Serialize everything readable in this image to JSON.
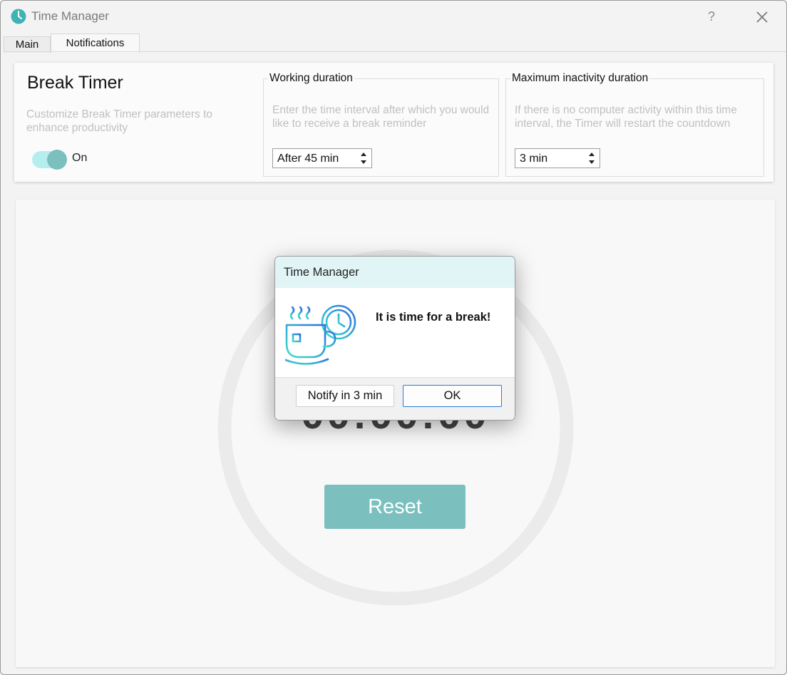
{
  "window": {
    "title": "Time Manager",
    "help_label": "?",
    "app_icon": "clock-icon",
    "close_icon": "close-icon"
  },
  "tabs": [
    {
      "label": "Main",
      "selected": false
    },
    {
      "label": "Notifications",
      "selected": true
    }
  ],
  "break_timer": {
    "title": "Break Timer",
    "description": "Customize Break Timer parameters to enhance productivity",
    "toggle_state": "On",
    "toggle_on": true
  },
  "working_duration": {
    "label": "Working duration",
    "description": "Enter the time interval after which you would like to receive a break reminder",
    "value": "After 45 min"
  },
  "inactivity_duration": {
    "label": "Maximum inactivity duration",
    "description": "If there is no computer activity within this time interval, the Timer will restart the countdown",
    "value": "3 min"
  },
  "timer": {
    "display": "00:00:00",
    "reset_label": "Reset"
  },
  "dialog": {
    "title": "Time Manager",
    "message": "It is time for a break!",
    "icon": "coffee-cup-clock-icon",
    "notify_label": "Notify in 3 min",
    "ok_label": "OK"
  },
  "colors": {
    "accent": "#7bbfbf",
    "toggle_track": "#b6eef0",
    "dialog_header": "#e2f5f6",
    "ok_border": "#2a7bd4",
    "icon_gradient_start": "#3fd6c8",
    "icon_gradient_end": "#2f6fe0"
  }
}
